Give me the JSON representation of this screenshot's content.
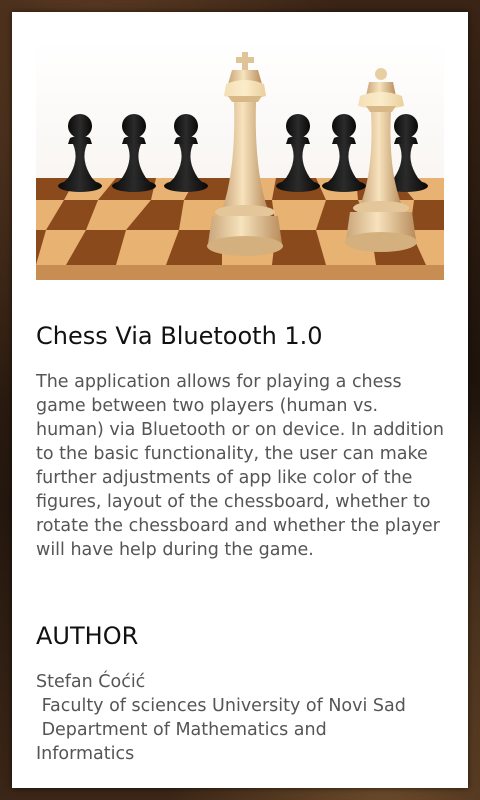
{
  "about": {
    "title": "Chess Via Bluetooth 1.0",
    "description": "The application allows for playing a chess game between two players (human vs. human) via Bluetooth or on device. In addition to the basic functionality, the user can make further adjustments of app like color of the figures, layout of the chessboard, whether to rotate the chessboard and whether the player will have help during the game.",
    "author_heading": "AUTHOR",
    "author_lines": [
      "Stefan Ćoćić",
      " Faculty of sciences University of Novi Sad",
      " Department of Mathematics and",
      "Informatics"
    ]
  },
  "image": {
    "icon": "chess-pieces-image"
  }
}
